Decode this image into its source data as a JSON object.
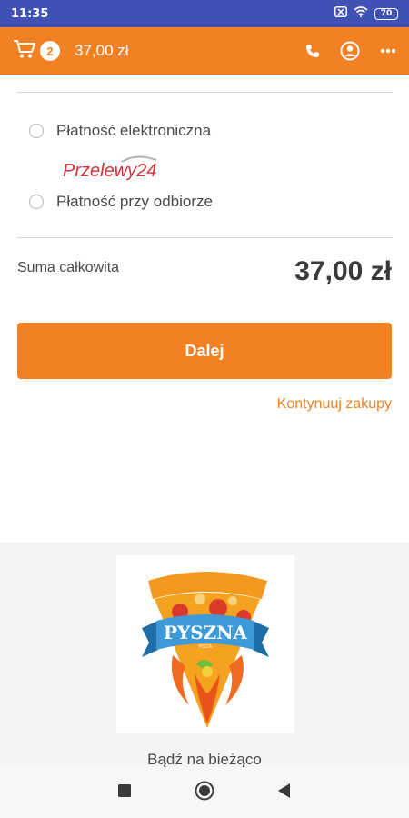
{
  "status_bar": {
    "time": "11:35",
    "battery": "70",
    "icons": [
      "sim-off-icon",
      "wifi-icon",
      "battery-icon"
    ]
  },
  "header": {
    "cart_count": "2",
    "cart_total": "37,00 zł",
    "actions": [
      "phone-icon",
      "account-icon",
      "more-icon"
    ]
  },
  "payment": {
    "options": [
      {
        "label": "Płatność elektroniczna",
        "logo_text": "Przelewy24",
        "selected": false
      },
      {
        "label": "Płatność przy odbiorze",
        "selected": false
      }
    ]
  },
  "summary": {
    "total_label": "Suma całkowita",
    "total_value": "37,00 zł"
  },
  "actions": {
    "next_label": "Dalej",
    "continue_label": "Kontynuuj zakupy"
  },
  "footer": {
    "brand": "PYSZNA",
    "brand_sub": "PIZZA",
    "stay_updated": "Bądź na bieżąco"
  },
  "colors": {
    "accent": "#f28123",
    "status_bar": "#3f51b5",
    "text": "#4a4a4a"
  }
}
